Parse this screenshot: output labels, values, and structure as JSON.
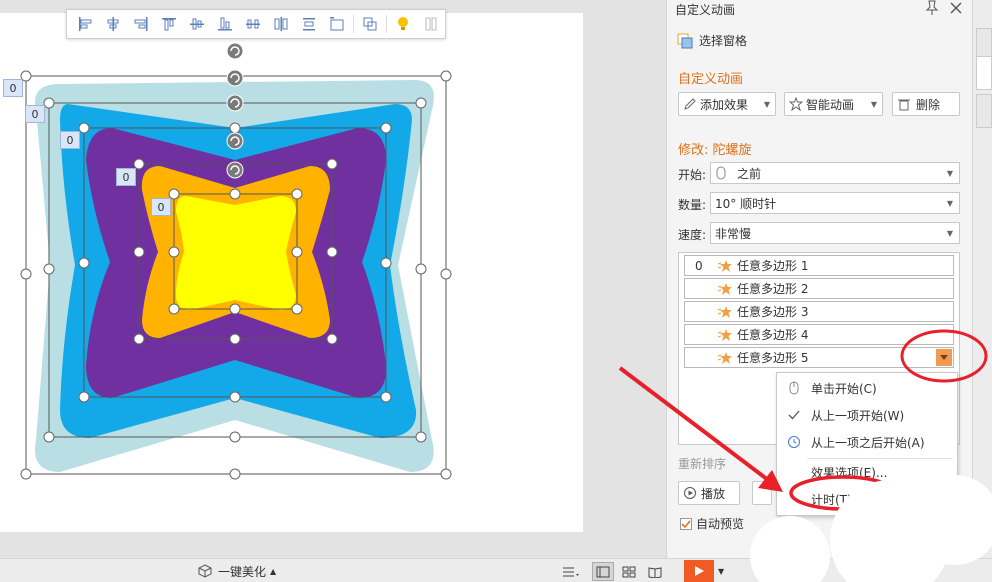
{
  "toolbar": {
    "icons": [
      "align-left-icon",
      "align-center-icon",
      "align-right-icon",
      "align-top-icon",
      "align-middle-icon",
      "align-bottom-icon",
      "distribute-horizontal-icon",
      "distribute-vertical-icon",
      "equal-spacing-icon",
      "fit-canvas-icon",
      "group-icon",
      "lightbulb-icon",
      "more-icon"
    ]
  },
  "slide": {
    "sequence_tags": [
      "0",
      "0",
      "0",
      "0",
      "0"
    ],
    "colors": {
      "outer": "#b9dfe4",
      "blue": "#13a9e8",
      "purple": "#7030a0",
      "orange": "#ffb300",
      "yellow": "#ffff00"
    }
  },
  "panel": {
    "title": "自定义动画",
    "selection_pane": "选择窗格",
    "section_title": "自定义动画",
    "add_effect": "添加效果",
    "smart_animation": "智能动画",
    "delete": "删除",
    "modify_title": "修改: 陀螺旋",
    "start_label": "开始:",
    "start_value": "之前",
    "amount_label": "数量:",
    "amount_value": "10° 顺时针",
    "speed_label": "速度:",
    "speed_value": "非常慢",
    "items": [
      {
        "num": "0",
        "label": "任意多边形 1"
      },
      {
        "num": "",
        "label": "任意多边形 2"
      },
      {
        "num": "",
        "label": "任意多边形 3"
      },
      {
        "num": "",
        "label": "任意多边形 4"
      },
      {
        "num": "",
        "label": "任意多边形 5"
      }
    ],
    "reorder": "重新排序",
    "play": "播放",
    "autopreview": "自动预览",
    "accent": "#e0701b"
  },
  "menu": {
    "items": [
      "单击开始(C)",
      "从上一项开始(W)",
      "从上一项之后开始(A)",
      "效果选项(E)...",
      "计时(T)..."
    ]
  },
  "statusbar": {
    "beautify": "一键美化"
  }
}
